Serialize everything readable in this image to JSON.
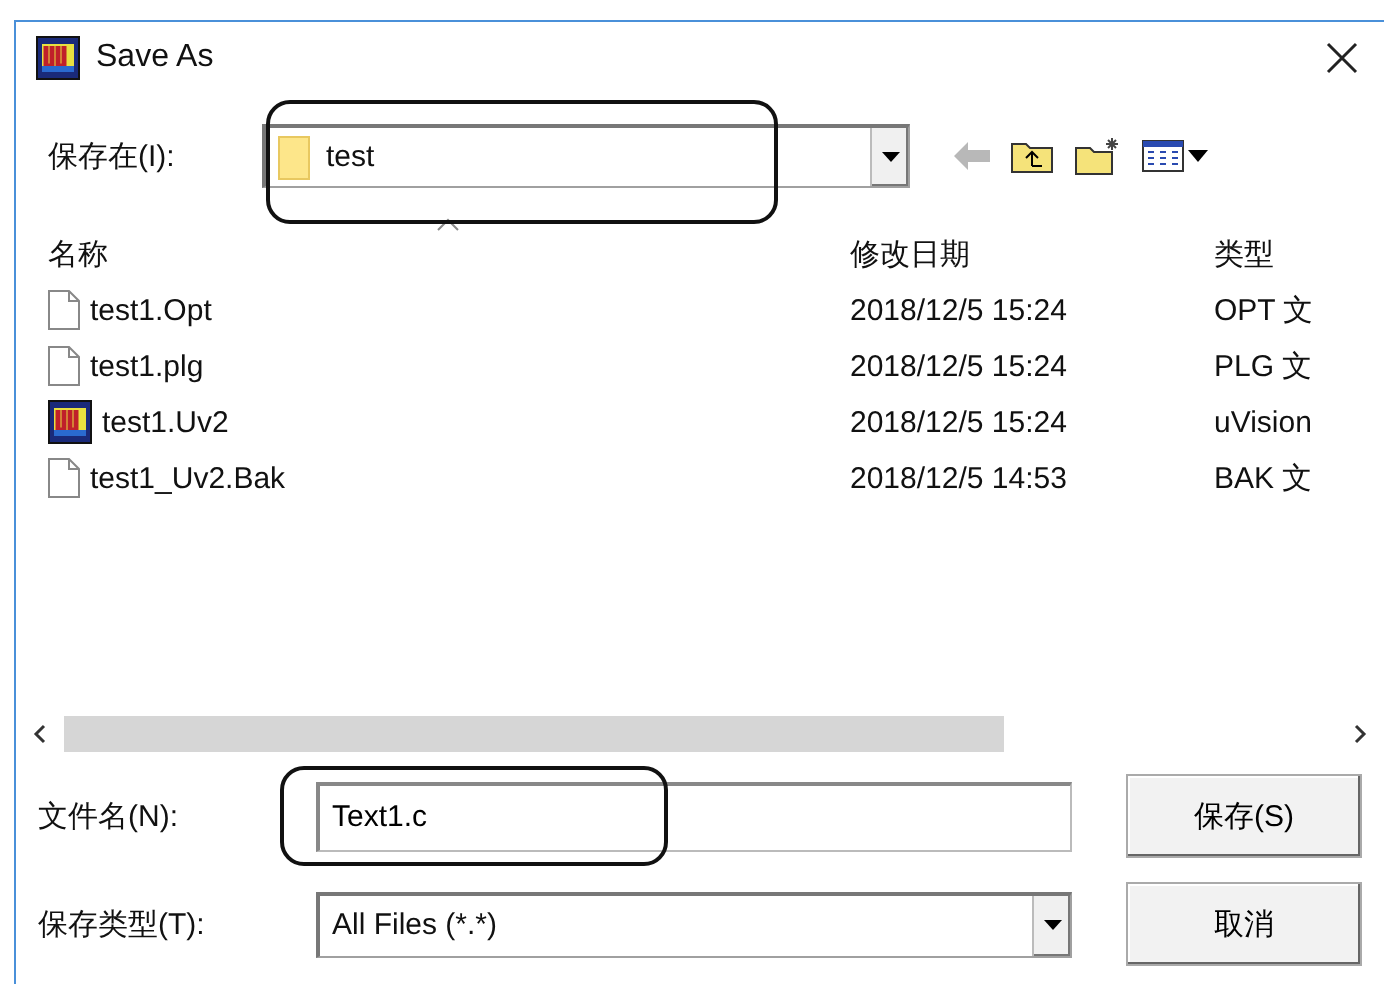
{
  "window": {
    "title": "Save As"
  },
  "look_in": {
    "label": "保存在(I):",
    "value": "test"
  },
  "file_list": {
    "columns": [
      "名称",
      "修改日期",
      "类型"
    ],
    "rows": [
      {
        "kind": "document",
        "name": "test1.Opt",
        "modified": "2018/12/5 15:24",
        "type": "OPT 文"
      },
      {
        "kind": "document",
        "name": "test1.plg",
        "modified": "2018/12/5 15:24",
        "type": "PLG 文"
      },
      {
        "kind": "uvision",
        "name": "test1.Uv2",
        "modified": "2018/12/5 15:24",
        "type": "uVision"
      },
      {
        "kind": "document",
        "name": "test1_Uv2.Bak",
        "modified": "2018/12/5 14:53",
        "type": "BAK 文"
      }
    ]
  },
  "file_name": {
    "label": "文件名(N):",
    "value": "Text1.c"
  },
  "file_type": {
    "label": "保存类型(T):",
    "value": "All Files (*.*)"
  },
  "buttons": [
    "保存(S)",
    "取消"
  ]
}
